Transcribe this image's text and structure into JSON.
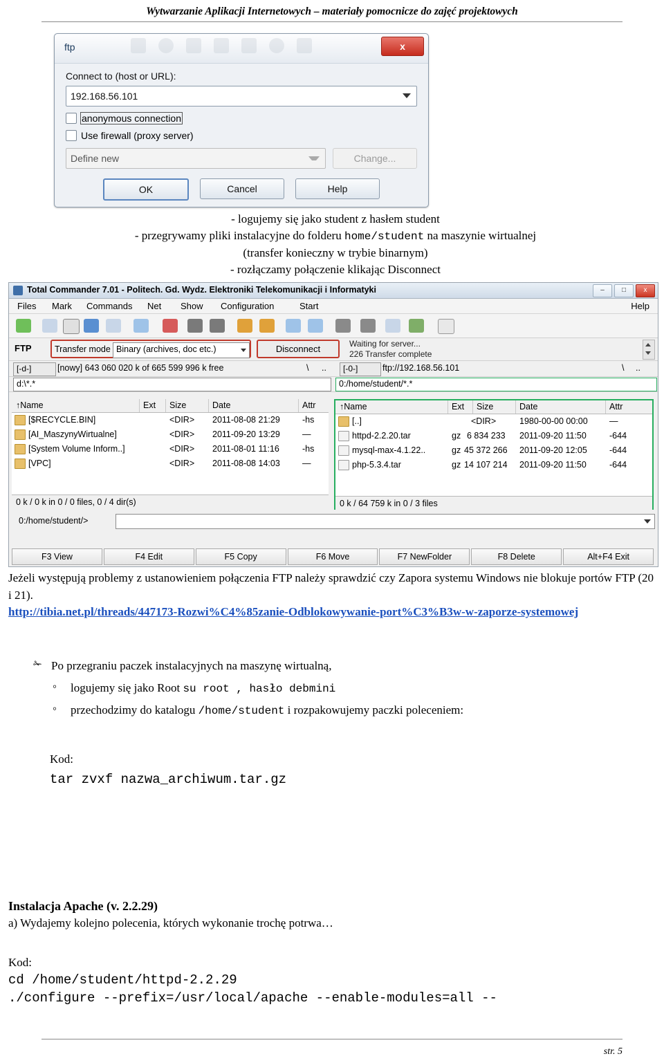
{
  "header": {
    "title": "Wytwarzanie Aplikacji Internetowych – materiały pomocnicze do zajęć projektowych"
  },
  "ftp_dialog": {
    "title": "ftp",
    "close_label": "x",
    "host_label": "Connect to (host or URL):",
    "host_value": "192.168.56.101",
    "anonymous_label": "anonymous connection",
    "firewall_label": "Use firewall (proxy server)",
    "firewall_combo_value": "Define new",
    "change_label": "Change...",
    "ok_label": "OK",
    "cancel_label": "Cancel",
    "help_label": "Help"
  },
  "notes1": {
    "line1": "- logujemy się jako student z hasłem student",
    "line2_a": "- przegrywamy pliki instalacyjne do folderu ",
    "line2_mono": "home/student",
    "line2_b": " na maszynie wirtualnej",
    "line3": "(transfer konieczny w trybie binarnym)",
    "line4": "- rozłączamy połączenie klikając Disconnect"
  },
  "total_commander": {
    "title": "Total Commander 7.01 - Politech. Gd. Wydz. Elektroniki Telekomunikacji i Informatyki",
    "window_buttons": [
      "–",
      "□",
      "x"
    ],
    "menu": [
      "Files",
      "Mark",
      "Commands",
      "Net",
      "Show",
      "Configuration",
      "Start",
      "Help"
    ],
    "ftp_label": "FTP",
    "transfer_mode_label": "Transfer mode",
    "transfer_mode_value": "Binary (archives, doc etc.)",
    "disconnect_label": "Disconnect",
    "status_line1": "Waiting for server...",
    "status_line2": "226 Transfer complete",
    "left_drive": "[-d-]",
    "left_free": "[nowy]  643 060 020 k of 665 599 996 k free",
    "left_backslash": "\\",
    "left_dots": "..",
    "right_drive": "[-0-]",
    "right_url": "ftp://192.168.56.101",
    "right_backslash": "\\",
    "right_dots": "..",
    "left_path": "d:\\*.*",
    "right_path": "0:/home/student/*.*",
    "star_dot_star": "* *",
    "columns": [
      "↑Name",
      "Ext",
      "Size",
      "Date",
      "Attr"
    ],
    "left_rows": [
      {
        "name": "[$RECYCLE.BIN]",
        "ext": "",
        "size": "<DIR>",
        "date": "2011-08-08 21:29",
        "attr": "-hs"
      },
      {
        "name": "[AI_MaszynyWirtualne]",
        "ext": "",
        "size": "<DIR>",
        "date": "2011-09-20 13:29",
        "attr": "—"
      },
      {
        "name": "[System Volume Inform..]",
        "ext": "",
        "size": "<DIR>",
        "date": "2011-08-01 11:16",
        "attr": "-hs"
      },
      {
        "name": "[VPC]",
        "ext": "",
        "size": "<DIR>",
        "date": "2011-08-08 14:03",
        "attr": "—"
      }
    ],
    "right_rows": [
      {
        "name": "[..]",
        "ext": "",
        "size": "<DIR>",
        "date": "1980-00-00 00:00",
        "attr": "—"
      },
      {
        "name": "httpd-2.2.20.tar",
        "ext": "gz",
        "size": "6 834 233",
        "date": "2011-09-20 11:50",
        "attr": "-644"
      },
      {
        "name": "mysql-max-4.1.22..",
        "ext": "gz",
        "size": "45 372 266",
        "date": "2011-09-20 12:05",
        "attr": "-644"
      },
      {
        "name": "php-5.3.4.tar",
        "ext": "gz",
        "size": "14 107 214",
        "date": "2011-09-20 11:50",
        "attr": "-644"
      }
    ],
    "left_footer": "0 k / 0 k in 0 / 0 files, 0 / 4 dir(s)",
    "right_footer": "0 k / 64 759 k in 0 / 3 files",
    "command_prompt": "0:/home/student/>",
    "fkeys": [
      "F3 View",
      "F4 Edit",
      "F5 Copy",
      "F6 Move",
      "F7 NewFolder",
      "F8 Delete",
      "Alt+F4 Exit"
    ]
  },
  "notes2": {
    "para1": "Jeżeli występują problemy z ustanowieniem połączenia FTP należy sprawdzić czy Zapora systemu Windows nie blokuje portów FTP (20 i 21).",
    "link": "http://tibia.net.pl/threads/447173-Rozwi%C4%85zanie-Odblokowywanie-port%C3%B3w-w-zaporze-systemowej"
  },
  "bullets": {
    "b1": "Po przegraniu paczek instalacyjnych na maszynę wirtualną,",
    "b2_a": "logujemy się jako Root ",
    "b2_mono": "su root  , hasło debmini",
    "b3_a": "przechodzimy do katalogu ",
    "b3_mono": "/home/student",
    "b3_b": " i rozpakowujemy paczki poleceniem:",
    "kod_label": "Kod:",
    "kod_cmd": "tar zvxf nazwa_archiwum.tar.gz"
  },
  "section": {
    "title": "Instalacja Apache (v. 2.2.29)",
    "subtitle": "a) Wydajemy kolejno polecenia, których wykonanie trochę potrwa…",
    "kod_label": "Kod:",
    "cmd1": "cd /home/student/httpd-2.2.29",
    "cmd2": "./configure --prefix=/usr/local/apache --enable-modules=all --"
  },
  "footer": {
    "page": "str. 5"
  }
}
